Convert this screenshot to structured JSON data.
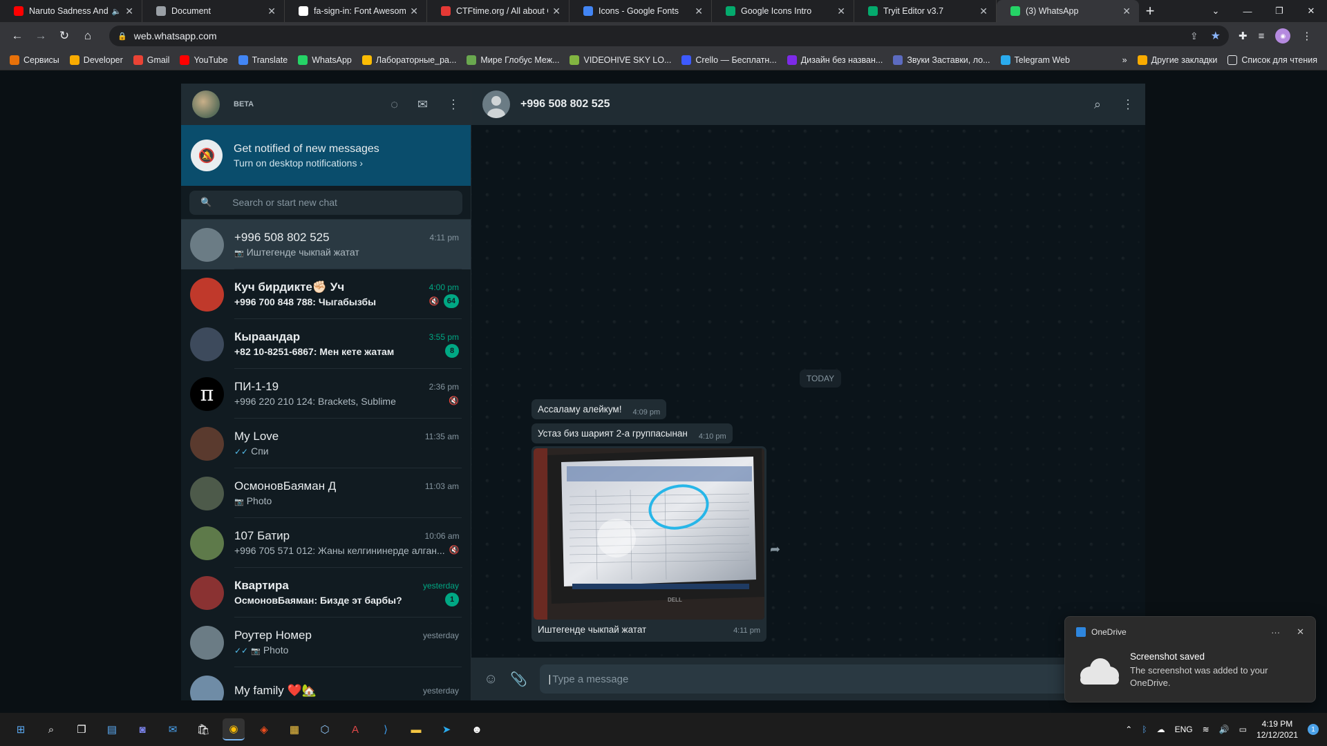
{
  "browser": {
    "tabs": [
      {
        "title": "Naruto Sadness And S",
        "favicon_color": "#ff0000",
        "muted": true
      },
      {
        "title": "Document",
        "favicon_color": "#9aa0a6"
      },
      {
        "title": "fa-sign-in: Font Awesome",
        "favicon_color": "#ffffff"
      },
      {
        "title": "CTFtime.org / All about CT",
        "favicon_color": "#e53935"
      },
      {
        "title": "Icons - Google Fonts",
        "favicon_color": "#4285f4"
      },
      {
        "title": "Google Icons Intro",
        "favicon_color": "#04aa6d"
      },
      {
        "title": "Tryit Editor v3.7",
        "favicon_color": "#04aa6d"
      },
      {
        "title": "(3) WhatsApp",
        "favicon_color": "#25d366",
        "active": true
      }
    ],
    "url": "web.whatsapp.com",
    "bookmarks": [
      {
        "label": "Сервисы",
        "color": "#e8710a"
      },
      {
        "label": "Developer",
        "color": "#f9ab00"
      },
      {
        "label": "Gmail",
        "color": "#ea4335"
      },
      {
        "label": "YouTube",
        "color": "#ff0000"
      },
      {
        "label": "Translate",
        "color": "#4285f4"
      },
      {
        "label": "WhatsApp",
        "color": "#25d366"
      },
      {
        "label": "Лабораторные_ра...",
        "color": "#fbbc04"
      },
      {
        "label": "Мире Глобус Меж...",
        "color": "#6aa84f"
      },
      {
        "label": "VIDEOHIVE SKY LO...",
        "color": "#82b541"
      },
      {
        "label": "Crello — Бесплатн...",
        "color": "#3d5afe"
      },
      {
        "label": "Дизайн без назван...",
        "color": "#7d2ae8"
      },
      {
        "label": "Звуки Заставки, ло...",
        "color": "#5c6bc0"
      },
      {
        "label": "Telegram Web",
        "color": "#2aabee"
      }
    ],
    "bookmarks_overflow": "»",
    "other_bookmarks": "Другие закладки",
    "reading_list": "Список для чтения"
  },
  "sidebar": {
    "beta_label": "BETA",
    "notification": {
      "title": "Get notified of new messages",
      "subtitle": "Turn on desktop notifications ›"
    },
    "search_placeholder": "Search or start new chat",
    "chats": [
      {
        "name": "+996 508 802 525",
        "time": "4:11 pm",
        "preview": "Иштегенде чыкпай жатат",
        "camera": true,
        "selected": true,
        "avatar_color": "#6b7c85"
      },
      {
        "name": "Куч бирдикте✊🏻 Уч",
        "time": "4:00 pm",
        "preview": "+996 700 848 788: Чыгабызбы",
        "bold": true,
        "muted": true,
        "badge": "64",
        "avatar_color": "#c0392b"
      },
      {
        "name": "Кыраандар",
        "time": "3:55 pm",
        "preview": "+82 10-8251-6867: Мен кете жатам",
        "bold": true,
        "badge": "8",
        "avatar_color": "#3d4a5c"
      },
      {
        "name": "ПИ-1-19",
        "time": "2:36 pm",
        "preview": "+996 220 210 124: Brackets, Sublime",
        "muted": true,
        "avatar_color": "#000000",
        "avatar_glyph": "π"
      },
      {
        "name": "My Love",
        "time": "11:35 am",
        "preview": "Спи",
        "ticks": true,
        "avatar_color": "#5a3a2e"
      },
      {
        "name": "ОсмоновБаяман Д",
        "time": "11:03 am",
        "preview": "Photo",
        "camera": true,
        "avatar_color": "#4d5a4a"
      },
      {
        "name": "107 Батир",
        "time": "10:06 am",
        "preview": "+996 705 571 012: Жаны келгининерде алган...",
        "muted": true,
        "avatar_color": "#5e7a4a"
      },
      {
        "name": "Квартира",
        "time": "yesterday",
        "preview": "ОсмоновБаяман: Бизде эт барбы?",
        "bold": true,
        "badge": "1",
        "avatar_color": "#8a3232"
      },
      {
        "name": "Роутер Номер",
        "time": "yesterday",
        "preview": "Photo",
        "ticks": true,
        "camera": true,
        "avatar_color": "#6b7c85"
      },
      {
        "name": "My family ❤️🏡",
        "time": "yesterday",
        "preview": "",
        "avatar_color": "#6f8ca6"
      }
    ]
  },
  "conversation": {
    "contact": "+996 508 802 525",
    "date_divider": "TODAY",
    "messages": [
      {
        "text": "Ассаламу алейкум!",
        "time": "4:09 pm"
      },
      {
        "text": "Устаз биз шарият 2-а группасынан",
        "time": "4:10 pm"
      }
    ],
    "image_message": {
      "caption": "Иштегенде чыкпай жатат",
      "time": "4:11 pm",
      "monitor_brand": "DELL"
    },
    "composer_placeholder": "Type a message"
  },
  "toast": {
    "app": "OneDrive",
    "more": "···",
    "close": "✕",
    "title": "Screenshot saved",
    "text": "The screenshot was added to your OneDrive."
  },
  "taskbar": {
    "tray_language": "ENG",
    "time": "4:19 PM",
    "date": "12/12/2021",
    "notification_count": "1"
  }
}
